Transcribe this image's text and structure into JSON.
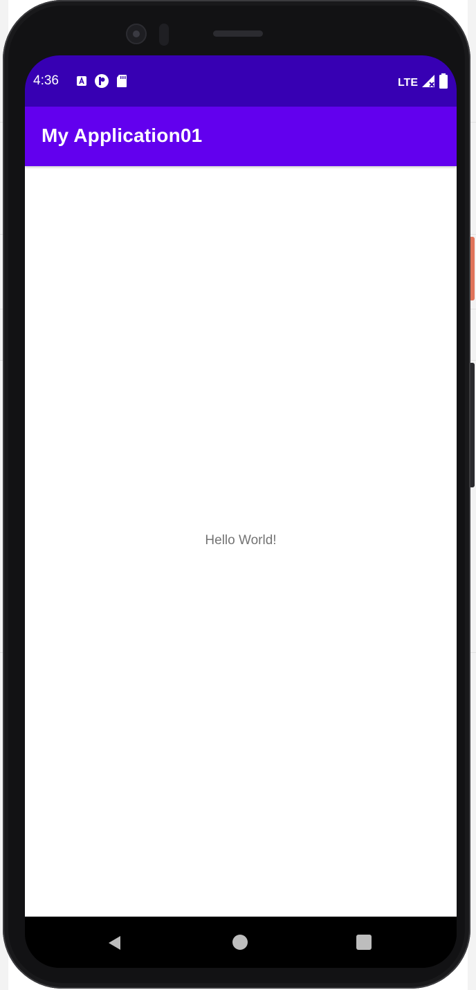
{
  "status_bar": {
    "time": "4:36",
    "network": "LTE",
    "icons_left": [
      "app-a-icon",
      "notification-circle-icon",
      "sd-card-icon"
    ],
    "icons_right": [
      "signal-icon",
      "battery-icon"
    ],
    "color": "#3700b3"
  },
  "app_bar": {
    "title": "My Application01",
    "color": "#6200ee"
  },
  "main": {
    "hello_text": "Hello World!"
  },
  "navigation_bar": {
    "buttons": [
      "back",
      "home",
      "recents"
    ]
  }
}
